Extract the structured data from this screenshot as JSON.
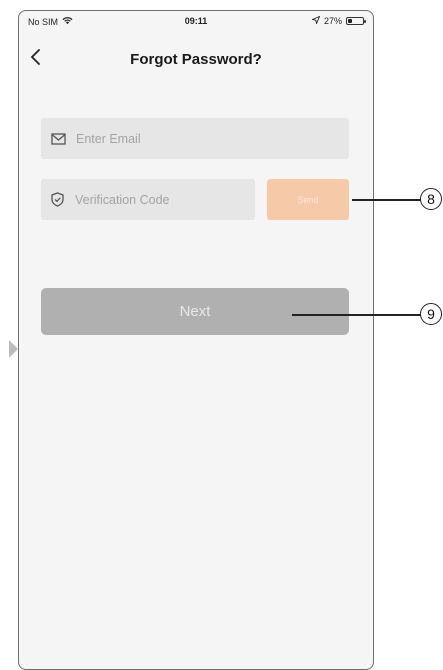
{
  "status_bar": {
    "carrier": "No SIM",
    "time": "09:11",
    "battery": "27%",
    "battery_level": 0.27
  },
  "nav": {
    "back_glyph": "<",
    "title": "Forgot Password?"
  },
  "form": {
    "email_placeholder": "Enter Email",
    "code_placeholder": "Verification Code",
    "send_label": "Send",
    "next_label": "Next"
  },
  "callouts": {
    "send": "8",
    "next": "9"
  },
  "colors": {
    "send_button": "#f6c9a8",
    "next_button": "#b0b0b0",
    "field_bg": "#e6e6e6"
  }
}
